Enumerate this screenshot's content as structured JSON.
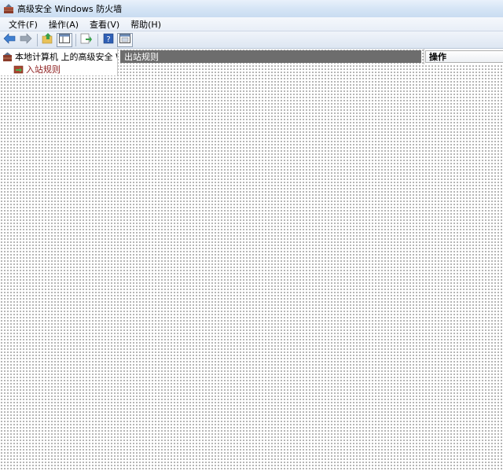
{
  "window": {
    "title": "高级安全 Windows 防火墙",
    "icon": "firewall-icon"
  },
  "menu": {
    "items": [
      {
        "label": "文件(F)"
      },
      {
        "label": "操作(A)"
      },
      {
        "label": "查看(V)"
      },
      {
        "label": "帮助(H)"
      }
    ]
  },
  "toolbar": {
    "buttons": [
      {
        "icon": "back-arrow-icon"
      },
      {
        "icon": "forward-arrow-icon"
      },
      {
        "icon": "up-folder-icon"
      },
      {
        "icon": "show-hide-tree-icon"
      },
      {
        "icon": "export-list-icon"
      },
      {
        "icon": "help-icon"
      },
      {
        "icon": "properties-icon"
      }
    ]
  },
  "tree": {
    "root_label": "本地计算机 上的高级安全 Windows 防火墙",
    "child_label": "入站规则"
  },
  "center": {
    "header": "出站规则"
  },
  "actions": {
    "header": "操作"
  },
  "colors": {
    "titlebar": "#d7e6f6",
    "center_header_bg": "#6d6d6d",
    "accent_red": "#c0392b"
  }
}
